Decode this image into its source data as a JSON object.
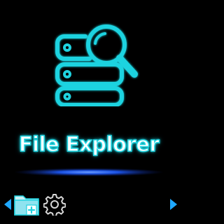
{
  "screen": {
    "title": "File Explorer"
  },
  "menu": {
    "items": [
      {
        "icon": "folder-add-icon",
        "selected": true
      },
      {
        "icon": "gear-icon",
        "selected": false
      }
    ]
  },
  "colors": {
    "background": "#000000",
    "accent": "#1fd3e0",
    "glow": "#1e5cff",
    "arrow": "#1fa8ff",
    "title_fill": "#ffffff"
  }
}
